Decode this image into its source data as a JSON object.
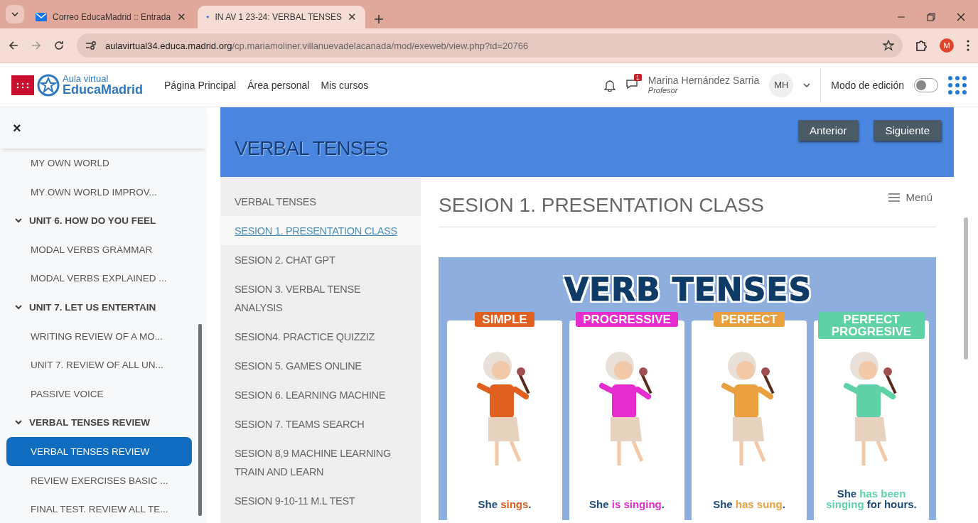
{
  "browser": {
    "tabs": [
      {
        "title": "Correo EducaMadrid :: Entrada",
        "close": "✕",
        "selected": false
      },
      {
        "title": "IN AV 1 23-24: VERBAL TENSES",
        "close": "✕",
        "selected": true
      }
    ],
    "url_host": "aulavirtual34.educa.madrid.org",
    "url_path": "/cp.mariamoliner.villanuevadelacanada/mod/exeweb/view.php?id=20766",
    "profile_initial": "M"
  },
  "header": {
    "logo_top": "Aula virtual",
    "logo_bottom": "EducaMadrid",
    "nav": [
      "Página Principal",
      "Área personal",
      "Mis cursos"
    ],
    "messages_badge": "1",
    "user_name": "Marina Hernández Sarria",
    "user_role": "Profesor",
    "avatar_initials": "MH",
    "edit_mode": {
      "label": "Modo de edición",
      "on": false
    }
  },
  "drawer": {
    "close": "×",
    "items": [
      {
        "label": "MY OWN WORLD",
        "selected": false
      },
      {
        "label": "MY OWN WORLD IMPROV...",
        "selected": false
      },
      {
        "label": "UNIT 6. HOW DO YOU FEEL",
        "selected": false,
        "expanded": true,
        "children": [
          {
            "label": "MODAL VERBS GRAMMAR",
            "selected": false
          },
          {
            "label": "MODAL VERBS EXPLAINED ...",
            "selected": false
          }
        ]
      },
      {
        "label": "UNIT 7. LET US ENTERTAIN",
        "selected": false,
        "expanded": true,
        "children": [
          {
            "label": "WRITING REVIEW OF A MO...",
            "selected": false
          },
          {
            "label": "UNIT 7. REVIEW OF ALL UN...",
            "selected": false
          },
          {
            "label": "PASSIVE VOICE",
            "selected": false
          }
        ]
      },
      {
        "label": "VERBAL TENSES REVIEW",
        "selected": false,
        "expanded": true,
        "children": [
          {
            "label": "VERBAL TENSES REVIEW",
            "selected": true
          },
          {
            "label": "REVIEW EXERCISES BASIC ...",
            "selected": false
          },
          {
            "label": "FINAL TEST. REVIEW ALL TE...",
            "selected": false
          }
        ]
      }
    ]
  },
  "resource": {
    "title": "VERBAL TENSES",
    "prev": "Anterior",
    "next": "Siguiente",
    "menu": "Menú",
    "pages": [
      {
        "label": "VERBAL TENSES",
        "selected": false
      },
      {
        "label": "SESION 1. PRESENTATION CLASS",
        "selected": true
      },
      {
        "label": "SESION 2. CHAT GPT",
        "selected": false
      },
      {
        "label": "SESION 3. VERBAL TENSE ANALYSIS",
        "selected": false
      },
      {
        "label": "SESION4. PRACTICE QUIZZIZ",
        "selected": false
      },
      {
        "label": "SESION 5. GAMES ONLINE",
        "selected": false
      },
      {
        "label": "SESION 6. LEARNING MACHINE",
        "selected": false
      },
      {
        "label": "SESION 7. TEAMS SEARCH",
        "selected": false
      },
      {
        "label": "SESION 8,9 MACHINE LEARNING TRAIN AND LEARN",
        "selected": false
      },
      {
        "label": "SESION 9-10-11 M.L TEST",
        "selected": false
      }
    ],
    "page_title": "SESION 1. PRESENTATION CLASS",
    "poster": {
      "title": "VERB TENSES",
      "cards": [
        {
          "tag": "SIMPLE",
          "color": "#e0601f",
          "subject": "She",
          "verb": "sings",
          "rest": "."
        },
        {
          "tag": "PROGRESSIVE",
          "color": "#e62ccf",
          "subject": "She",
          "verb": "is singing",
          "rest": "."
        },
        {
          "tag": "PERFECT",
          "color": "#eba040",
          "subject": "She",
          "verb": "has sung",
          "rest": "."
        },
        {
          "tag": "PERFECT PROGRESIVE",
          "color": "#5ed2a6",
          "subject": "She",
          "verb": "has been singing",
          "rest": "for hours."
        }
      ]
    }
  }
}
